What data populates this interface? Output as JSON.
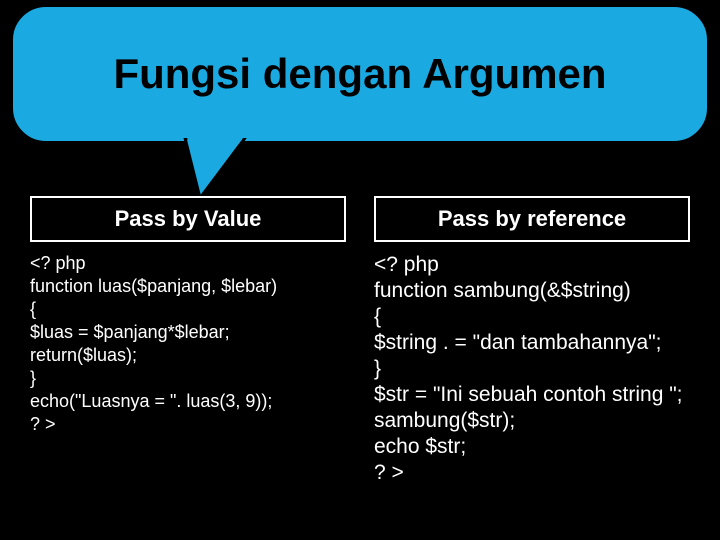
{
  "title": "Fungsi dengan Argumen",
  "columns": {
    "left": {
      "header": "Pass by Value",
      "code": "<? php\nfunction luas($panjang, $lebar)\n{\n$luas = $panjang*$lebar;\nreturn($luas);\n}\necho(\"Luasnya = \". luas(3, 9));\n? >"
    },
    "right": {
      "header": "Pass by reference",
      "code": "<? php\nfunction sambung(&$string)\n{\n$string . = \"dan tambahannya\";\n}\n$str = \"Ini sebuah contoh string \";\nsambung($str);\necho $str;\n? >"
    }
  }
}
